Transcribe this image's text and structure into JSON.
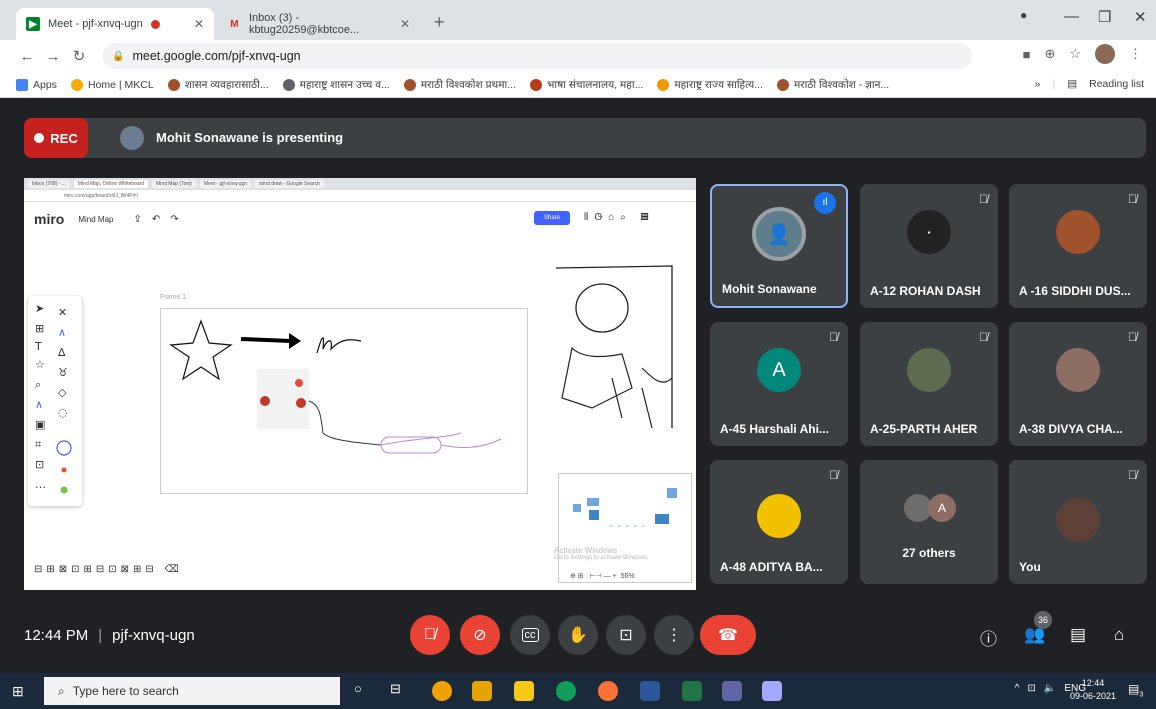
{
  "browser": {
    "tabs": [
      {
        "title": "Meet - pjf-xnvq-ugn",
        "active": true
      },
      {
        "title": "Inbox (3) - kbtug20259@kbtcoe...",
        "active": false
      }
    ],
    "url": "meet.google.com/pjf-xnvq-ugn",
    "bookmarks": [
      {
        "label": "Apps",
        "color": "#4285f4"
      },
      {
        "label": "Home | MKCL",
        "color": "#f9ab00"
      },
      {
        "label": "शासन व्यवहारासाठी...",
        "color": "#a0522d"
      },
      {
        "label": "महाराष्ट्र शासन उच्च व...",
        "color": "#5f6368"
      },
      {
        "label": "मराठी विश्वकोश प्रथमा...",
        "color": "#a0522d"
      },
      {
        "label": "भाषा संचालनालय, महा...",
        "color": "#b83b1e"
      },
      {
        "label": "महाराष्ट्र राज्य साहित्य...",
        "color": "#f29900"
      },
      {
        "label": "मराठी विश्वकोश - ज्ञान...",
        "color": "#a0522d"
      }
    ],
    "reading_list": "Reading list",
    "more_bookmarks": "»"
  },
  "meet": {
    "rec_label": "REC",
    "presenting_text": "Mohit Sonawane is presenting",
    "shared_screen": {
      "inner_tabs": [
        "Inbox (708) - ...",
        "Mind Map, Online Whiteboard",
        "Mind Map (Tool)",
        "Meet - pjf-xnvq-ugn",
        "mind draw - Google Search"
      ],
      "inner_url": "miro.com/app/board/o9J_lW4Pl=/",
      "app_name": "miro",
      "board_name": "Mind Map",
      "share_label": "Share",
      "frame_label": "Frame 1",
      "watermark_line1": "Activate Windows",
      "watermark_line2": "Go to Settings to activate Windows.",
      "zoom": "56%"
    },
    "participants": [
      {
        "name": "Mohit Sonawane",
        "avatar": "photo",
        "color": "#607d8b",
        "muted": false,
        "speaking": true
      },
      {
        "name": "A-12 ROHAN DASH",
        "avatar": "photo",
        "color": "#222222",
        "muted": true
      },
      {
        "name": "A -16 SIDDHI DUS...",
        "avatar": "photo",
        "color": "#a0522d",
        "muted": true
      },
      {
        "name": "A-45 Harshali Ahi...",
        "avatar": "A",
        "color": "#00897b",
        "muted": true
      },
      {
        "name": "A-25-PARTH AHER",
        "avatar": "photo",
        "color": "#5d6b4e",
        "muted": true
      },
      {
        "name": "A-38 DIVYA CHA...",
        "avatar": "photo",
        "color": "#8d6e63",
        "muted": true
      },
      {
        "name": "A-48 ADITYA BA...",
        "avatar": "photo",
        "color": "#f2c200",
        "muted": true
      },
      {
        "name": "27 others",
        "avatar": "group",
        "color": "#6d6d6d",
        "muted": false
      },
      {
        "name": "You",
        "avatar": "photo",
        "color": "#5d4037",
        "muted": true
      }
    ],
    "others_avatar_letter": "A",
    "time": "12:44 PM",
    "meeting_code": "pjf-xnvq-ugn",
    "participant_count": "36"
  },
  "taskbar": {
    "search_placeholder": "Type here to search",
    "lang": "ENG",
    "time": "12:44",
    "date": "09-06-2021",
    "notif_count": "3"
  }
}
